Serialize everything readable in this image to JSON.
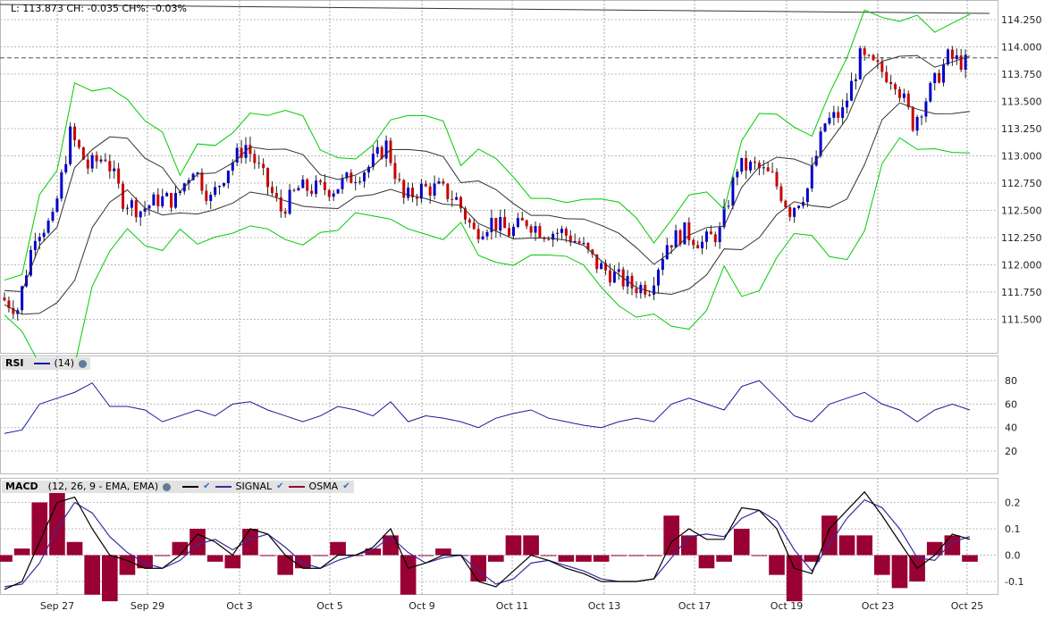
{
  "header": {
    "last": "L: 113.873",
    "change": "CH: -0.035",
    "change_pct": "CH%: -0.03%"
  },
  "rsi_legend": {
    "name": "RSI",
    "period": "(14)"
  },
  "macd_legend": {
    "name": "MACD",
    "params": "(12, 26, 9 - EMA, EMA)",
    "signal": "SIGNAL",
    "osma": "OSMA"
  },
  "colors": {
    "up": "#0000cc",
    "down": "#cc0000",
    "band": "#00cc00",
    "inner": "#333333",
    "rsi": "#1a1a9a",
    "macd": "#000000",
    "signal": "#3a2aa0",
    "osma": "#990033"
  },
  "chart_data": [
    {
      "type": "candlestick",
      "title": "Price",
      "ylim": [
        111.3,
        114.4
      ],
      "yticks": [
        "114.250",
        "114.000",
        "113.750",
        "113.500",
        "113.250",
        "113.000",
        "112.750",
        "112.500",
        "112.250",
        "112.000",
        "111.750",
        "111.500"
      ],
      "ytick_values": [
        114.25,
        114.0,
        113.75,
        113.5,
        113.25,
        113.0,
        112.75,
        112.5,
        112.25,
        112.0,
        111.75,
        111.5
      ],
      "reference_level": 113.9,
      "xticks": [
        "Sep 27",
        "Sep 29",
        "Oct 3",
        "Oct 5",
        "Oct 9",
        "Oct 11",
        "Oct 13",
        "Oct 17",
        "Oct 19",
        "Oct 23",
        "Oct 25"
      ],
      "close": [
        111.7,
        111.6,
        112.3,
        112.4,
        113.2,
        112.9,
        113.0,
        112.6,
        112.5,
        112.6,
        112.6,
        112.9,
        112.6,
        112.9,
        113.1,
        112.8,
        112.5,
        112.7,
        112.7,
        112.7,
        112.8,
        112.9,
        113.1,
        112.6,
        112.7,
        112.7,
        112.6,
        112.3,
        112.4,
        112.3,
        112.4,
        112.3,
        112.3,
        112.2,
        112.0,
        111.9,
        111.8,
        111.8,
        112.2,
        112.3,
        112.2,
        112.3,
        112.9,
        112.9,
        112.8,
        112.5,
        112.7,
        113.3,
        113.4,
        113.9,
        113.8,
        113.7,
        113.3,
        113.6,
        113.9,
        113.85
      ]
    },
    {
      "type": "line",
      "title": "RSI (14)",
      "ylim": [
        0,
        100
      ],
      "yticks": [
        "80",
        "60",
        "40",
        "20"
      ],
      "ytick_values": [
        80,
        60,
        40,
        20
      ],
      "values": [
        35,
        38,
        60,
        65,
        70,
        78,
        58,
        58,
        55,
        45,
        50,
        55,
        50,
        60,
        62,
        55,
        50,
        45,
        50,
        58,
        55,
        50,
        62,
        45,
        50,
        48,
        45,
        40,
        48,
        52,
        55,
        48,
        45,
        42,
        40,
        45,
        48,
        45,
        60,
        65,
        60,
        55,
        75,
        80,
        65,
        50,
        45,
        60,
        65,
        70,
        60,
        55,
        45,
        55,
        60,
        55
      ]
    },
    {
      "type": "line+bar",
      "title": "MACD (12, 26, 9 - EMA, EMA)",
      "ylim": [
        -0.14,
        0.27
      ],
      "yticks": [
        "0.2",
        "0.1",
        "0.0",
        "-0.1"
      ],
      "ytick_values": [
        0.2,
        0.1,
        0,
        -0.1
      ],
      "macd": [
        -0.13,
        -0.1,
        0.05,
        0.2,
        0.22,
        0.1,
        0,
        -0.02,
        -0.05,
        -0.05,
        0.0,
        0.08,
        0.05,
        0.0,
        0.1,
        0.08,
        0,
        -0.05,
        -0.05,
        0,
        0.0,
        0.03,
        0.1,
        -0.05,
        -0.03,
        0.0,
        0.0,
        -0.1,
        -0.12,
        -0.06,
        0.0,
        -0.02,
        -0.05,
        -0.07,
        -0.1,
        -0.1,
        -0.1,
        -0.09,
        0.05,
        0.1,
        0.06,
        0.06,
        0.18,
        0.17,
        0.1,
        -0.05,
        -0.07,
        0.1,
        0.17,
        0.24,
        0.15,
        0.05,
        -0.05,
        0,
        0.08,
        0.06
      ],
      "signal": [
        -0.12,
        -0.11,
        -0.03,
        0.1,
        0.2,
        0.16,
        0.07,
        0.01,
        -0.03,
        -0.05,
        -0.02,
        0.04,
        0.06,
        0.02,
        0.06,
        0.08,
        0.03,
        -0.03,
        -0.05,
        -0.02,
        0.0,
        0.02,
        0.07,
        0.01,
        -0.03,
        -0.01,
        0.0,
        -0.06,
        -0.11,
        -0.09,
        -0.03,
        -0.02,
        -0.04,
        -0.06,
        -0.09,
        -0.1,
        -0.1,
        -0.09,
        -0.01,
        0.07,
        0.08,
        0.07,
        0.14,
        0.17,
        0.13,
        0.02,
        -0.06,
        0.04,
        0.14,
        0.21,
        0.18,
        0.1,
        -0.01,
        -0.02,
        0.05,
        0.07
      ]
    }
  ]
}
